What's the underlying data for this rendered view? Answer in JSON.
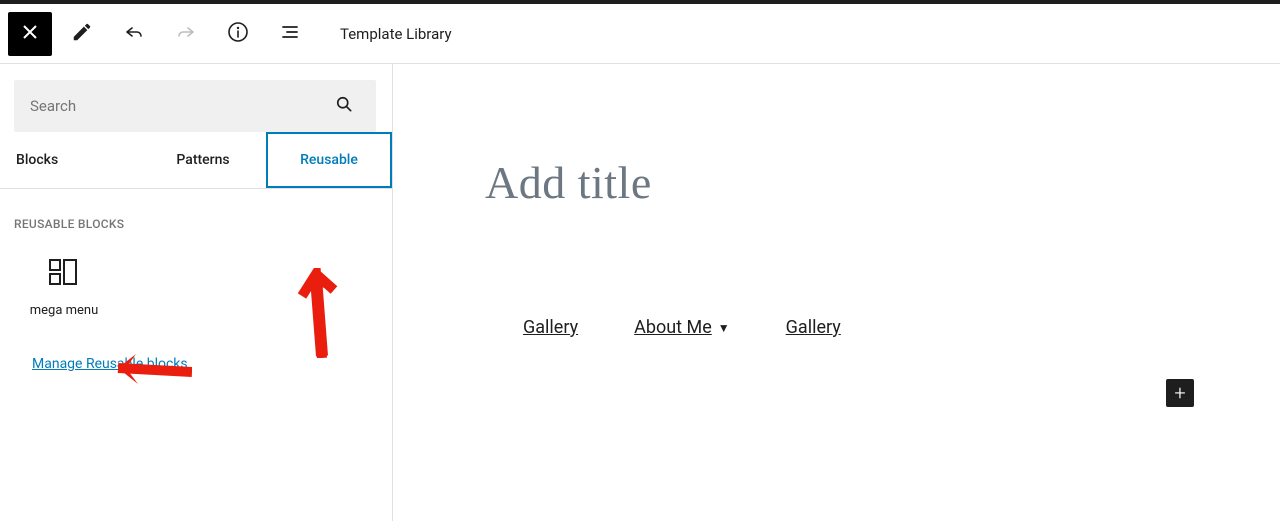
{
  "topbar": {
    "template_library_label": "Template Library"
  },
  "sidebar": {
    "search_placeholder": "Search",
    "tabs": {
      "blocks": "Blocks",
      "patterns": "Patterns",
      "reusable": "Reusable"
    },
    "section_title": "REUSABLE BLOCKS",
    "block_items": [
      {
        "label": "mega menu"
      }
    ],
    "manage_link": "Manage Reusable blocks"
  },
  "canvas": {
    "title_placeholder": "Add title",
    "nav": [
      {
        "label": "Gallery",
        "has_dropdown": false
      },
      {
        "label": "About Me",
        "has_dropdown": true
      },
      {
        "label": "Gallery",
        "has_dropdown": false
      }
    ]
  }
}
